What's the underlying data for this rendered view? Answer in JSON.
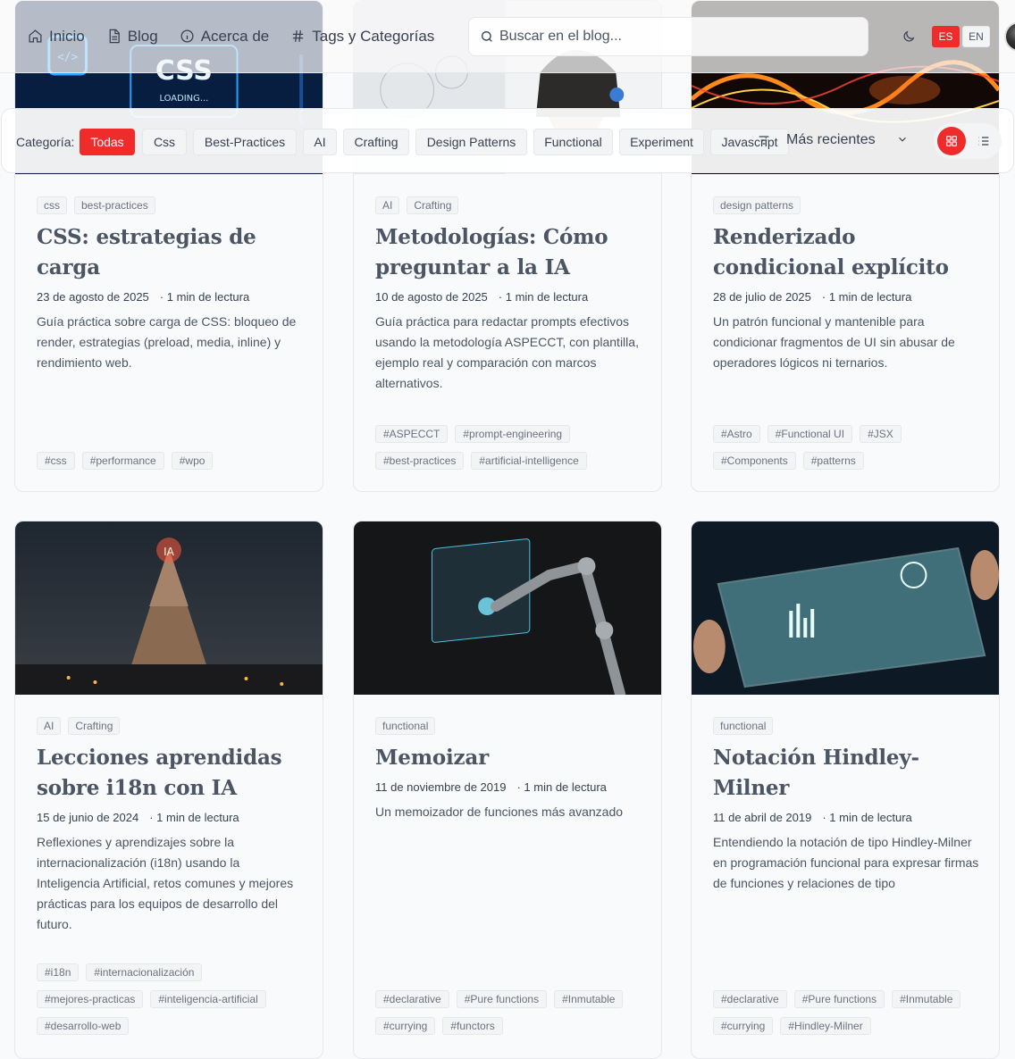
{
  "nav": {
    "items": [
      {
        "label": "Inicio",
        "icon": "home-icon"
      },
      {
        "label": "Blog",
        "icon": "document-icon"
      },
      {
        "label": "Acerca de",
        "icon": "info-icon"
      },
      {
        "label": "Tags y Categorías",
        "icon": "hash-icon"
      }
    ],
    "search_placeholder": "Buscar en el blog...",
    "theme_icon": "moon-icon",
    "lang_es": "ES",
    "lang_en": "EN"
  },
  "filters": {
    "label": "Categoría:",
    "chips": [
      "Todas",
      "Css",
      "Best-Practices",
      "AI",
      "Crafting",
      "Design Patterns",
      "Functional",
      "Experiment",
      "Javascript"
    ],
    "active": "Todas",
    "sort_label": "Más recientes",
    "view": "grid"
  },
  "colors": {
    "accent": "#ef2b2b",
    "chip_bg": "#f3f4f6",
    "text": "#374151"
  },
  "posts": [
    {
      "categories": [
        "css",
        "best-practices"
      ],
      "title": "CSS: estrategias de carga",
      "date": "23 de agosto de 2025",
      "read": "· 1 min de lectura",
      "description": "Guía práctica sobre carga de CSS: bloqueo de render, estrategias (preload, media, inline) y rendimiento web.",
      "tags": [
        "#css",
        "#performance",
        "#wpo"
      ],
      "image_text": "CSS LOADING..."
    },
    {
      "categories": [
        "AI",
        "Crafting"
      ],
      "title": "Metodologías: Cómo preguntar a la IA",
      "date": "10 de agosto de 2025",
      "read": "· 1 min de lectura",
      "description": "Guía práctica para redactar prompts efectivos usando la metodología ASPECCT, con plantilla, ejemplo real y comparación con marcos alternativos.",
      "tags": [
        "#ASPECCT",
        "#prompt-engineering",
        "#best-practices",
        "#artificial-intelligence"
      ]
    },
    {
      "categories": [
        "design patterns"
      ],
      "title": "Renderizado condicional explícito",
      "date": "28 de julio de 2025",
      "read": "· 1 min de lectura",
      "description": "Un patrón funcional y mantenible para condicionar fragmentos de UI sin abusar de operadores lógicos ni ternarios.",
      "tags": [
        "#Astro",
        "#Functional UI",
        "#JSX",
        "#Components",
        "#patterns"
      ]
    },
    {
      "categories": [
        "AI",
        "Crafting"
      ],
      "title": "Lecciones aprendidas sobre i18n con IA",
      "date": "15 de junio de 2024",
      "read": "· 1 min de lectura",
      "description": "Reflexiones y aprendizajes sobre la internacionalización (i18n) usando la Inteligencia Artificial, retos comunes y mejores prácticas para los equipos de desarrollo del futuro.",
      "tags": [
        "#i18n",
        "#internacionalización",
        "#mejores-practicas",
        "#inteligencia-artificial",
        "#desarrollo-web"
      ]
    },
    {
      "categories": [
        "functional"
      ],
      "title": "Memoizar",
      "date": "11 de noviembre de 2019",
      "read": "· 1 min de lectura",
      "description": "Un memoizador de funciones más avanzado",
      "tags": [
        "#declarative",
        "#Pure functions",
        "#Inmutable",
        "#currying",
        "#functors"
      ]
    },
    {
      "categories": [
        "functional"
      ],
      "title": "Notación Hindley-Milner",
      "date": "11 de abril de 2019",
      "read": "· 1 min de lectura",
      "description": "Entendiendo la notación de tipo Hindley-Milner en programación funcional para expresar firmas de funciones y relaciones de tipo",
      "tags": [
        "#declarative",
        "#Pure functions",
        "#Inmutable",
        "#currying",
        "#Hindley-Milner"
      ]
    }
  ]
}
